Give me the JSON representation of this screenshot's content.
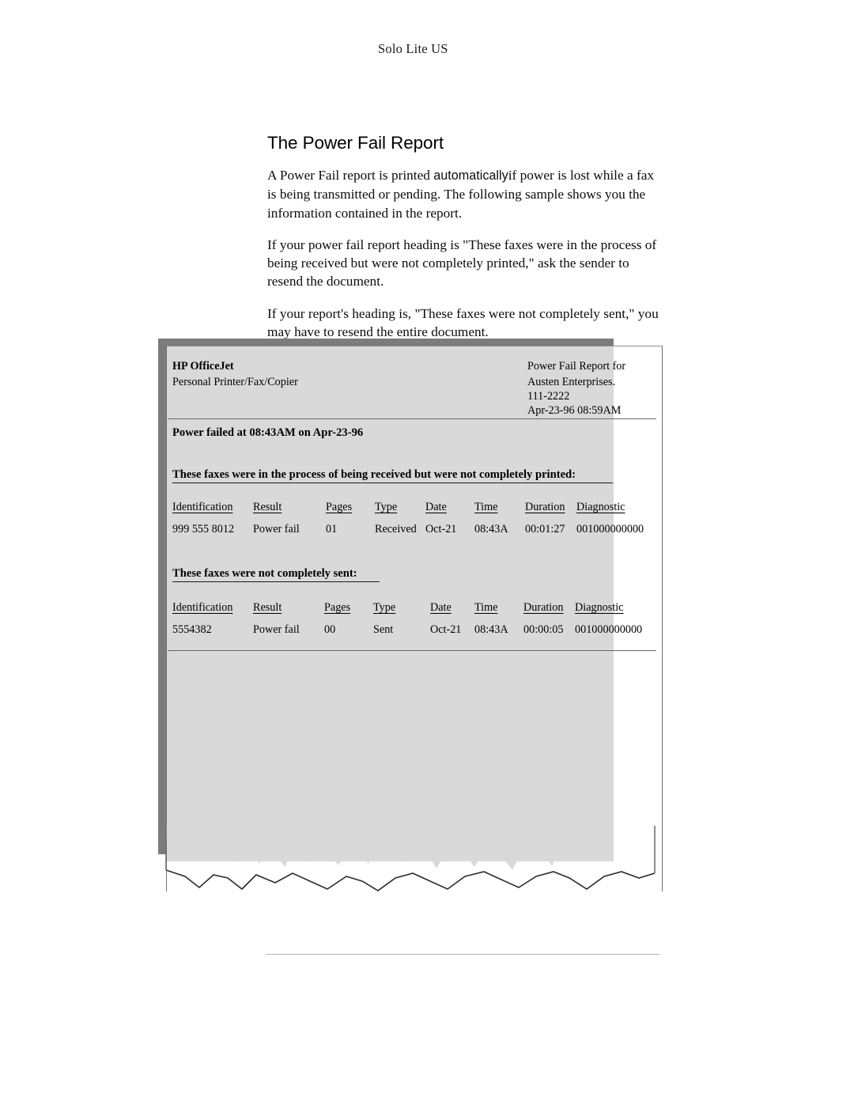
{
  "page": {
    "running_header": "Solo Lite US",
    "colors": {
      "paper_fill": "#d9d9d9",
      "drop_shadow": "#7c7c7c",
      "page_border": "#6f6f6f",
      "footer_rule": "#b4b4b4",
      "text": "#000000"
    }
  },
  "article": {
    "title": "The Power Fail Report",
    "paragraphs": [
      {
        "runs": [
          {
            "text": "A Power Fail report is printed ",
            "style": "serif"
          },
          {
            "text": "automatically",
            "style": "sans"
          },
          {
            "text": "if power is lost while a fax is being transmitted or pending. The following sample shows you the information contained in the report.",
            "style": "serif"
          }
        ]
      },
      {
        "runs": [
          {
            "text": "If your power fail report heading is \"These faxes were in the process of being received but were not completely printed,\" ask the sender to resend the document.",
            "style": "serif"
          }
        ]
      },
      {
        "runs": [
          {
            "text": "If your report's heading is, \"These faxes were not completely sent,\" you may have to resend the entire document.",
            "style": "serif"
          }
        ]
      }
    ]
  },
  "fax_sample": {
    "masthead": {
      "brand": "HP OfficeJet",
      "product_prefix": "Personal ",
      "product_bold": "Printer/Fax/Copier",
      "report_title": "Power Fail Report",
      "report_title_suffix": " for",
      "company": "Austen Enterprises.",
      "phone": "111-2222",
      "timestamp": "Apr-23-96 08:59AM"
    },
    "power_failed_line": "Power failed at 08:43AM on Apr-23-96",
    "sections": [
      {
        "heading": "These faxes were in the process of being received but were not completely printed:",
        "columns": [
          "Identification",
          "Result",
          "Pages",
          "Type",
          "Date",
          "Time",
          "Duration",
          "Diagnostic"
        ],
        "rows": [
          [
            "999 555 8012",
            "Power fail",
            "01",
            "Received",
            "Oct-21",
            "08:43A",
            "00:01:27",
            "001000000000"
          ]
        ]
      },
      {
        "heading": "These faxes were not completely sent:",
        "columns": [
          "Identification",
          "Result",
          "Pages",
          "Type",
          "Date",
          "Time",
          "Duration",
          "Diagnostic"
        ],
        "rows": [
          [
            "5554382",
            "Power fail",
            "00",
            "Sent",
            "Oct-21",
            "08:43A",
            "00:00:05",
            "001000000000"
          ]
        ]
      }
    ]
  }
}
